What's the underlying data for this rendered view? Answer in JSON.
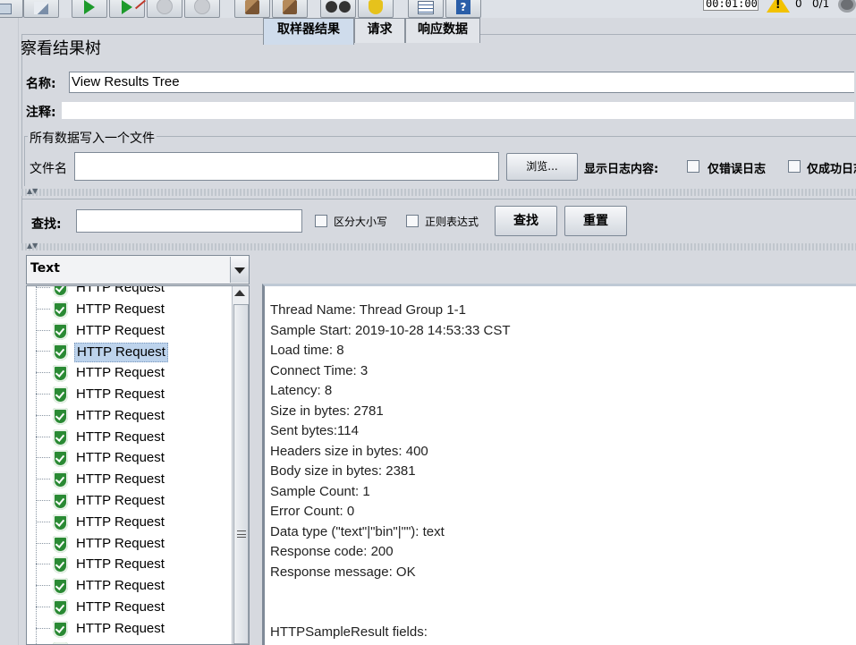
{
  "toolbar": {
    "timer": "00:01:00",
    "warning_count": "0",
    "thread_count": "0/1",
    "icons": [
      "paste-icon",
      "start-icon",
      "start-no-pause-icon",
      "stop-icon",
      "shutdown-icon",
      "clear-icon",
      "clear-all-icon",
      "search-icon",
      "reset-search-icon",
      "function-helper-icon",
      "help-icon",
      "warning-icon",
      "thread-status-icon"
    ]
  },
  "panel": {
    "title": "察看结果树",
    "name_label": "名称:",
    "name_value": "View Results Tree",
    "comment_label": "注释:",
    "comment_value": "",
    "file_section_legend": "所有数据写入一个文件",
    "file_label": "文件名",
    "file_value": "",
    "browse_label": "浏览...",
    "log_content_label": "显示日志内容:",
    "errors_only_label": "仅错误日志",
    "success_only_label": "仅成功日志"
  },
  "search": {
    "label": "查找:",
    "value": "",
    "case_sensitive_label": "区分大小写",
    "regex_label": "正则表达式",
    "find_label": "查找",
    "reset_label": "重置"
  },
  "tree": {
    "renderer": "Text",
    "items": [
      "HTTP Request",
      "HTTP Request",
      "HTTP Request",
      "HTTP Request",
      "HTTP Request",
      "HTTP Request",
      "HTTP Request",
      "HTTP Request",
      "HTTP Request",
      "HTTP Request",
      "HTTP Request",
      "HTTP Request",
      "HTTP Request",
      "HTTP Request",
      "HTTP Request",
      "HTTP Request",
      "HTTP Request",
      "HTTP Request"
    ],
    "selected_index": 3
  },
  "tabs": [
    {
      "label": "取样器结果",
      "active": true
    },
    {
      "label": "请求",
      "active": false
    },
    {
      "label": "响应数据",
      "active": false
    }
  ],
  "sampler_result": [
    "Thread Name: Thread Group 1-1",
    "Sample Start: 2019-10-28 14:53:33 CST",
    "Load time: 8",
    "Connect Time: 3",
    "Latency: 8",
    "Size in bytes: 2781",
    "Sent bytes:114",
    "Headers size in bytes: 400",
    "Body size in bytes: 2381",
    "Sample Count: 1",
    "Error Count: 0",
    "Data type (\"text\"|\"bin\"|\"\"): text",
    "Response code: 200",
    "Response message: OK",
    "",
    "",
    "HTTPSampleResult fields:"
  ]
}
